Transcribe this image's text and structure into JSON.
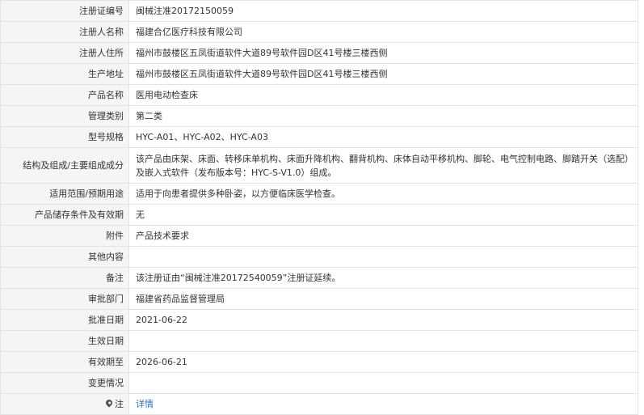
{
  "rows": [
    {
      "label": "注册证编号",
      "value": "闽械注准20172150059"
    },
    {
      "label": "注册人名称",
      "value": "福建合亿医疗科技有限公司"
    },
    {
      "label": "注册人住所",
      "value": "福州市鼓楼区五凤街道软件大道89号软件园D区41号楼三楼西侧"
    },
    {
      "label": "生产地址",
      "value": "福州市鼓楼区五凤街道软件大道89号软件园D区41号楼三楼西侧"
    },
    {
      "label": "产品名称",
      "value": "医用电动检查床"
    },
    {
      "label": "管理类别",
      "value": "第二类"
    },
    {
      "label": "型号规格",
      "value": "HYC-A01、HYC-A02、HYC-A03"
    },
    {
      "label": "结构及组成/主要组成成分",
      "value": "该产品由床架、床面、转移床单机构、床面升降机构、翻背机构、床体自动平移机构、脚轮、电气控制电路、脚踏开关（选配）及嵌入式软件（发布版本号：HYC-S-V1.0）组成。"
    },
    {
      "label": "适用范围/预期用途",
      "value": "适用于向患者提供多种卧姿，以方便临床医学检查。"
    },
    {
      "label": "产品储存条件及有效期",
      "value": "无"
    },
    {
      "label": "附件",
      "value": "产品技术要求"
    },
    {
      "label": "其他内容",
      "value": ""
    },
    {
      "label": "备注",
      "value": "该注册证由“闽械注准20172540059”注册证延续。"
    },
    {
      "label": "审批部门",
      "value": "福建省药品监督管理局"
    },
    {
      "label": "批准日期",
      "value": "2021-06-22"
    },
    {
      "label": "生效日期",
      "value": ""
    },
    {
      "label": "有效期至",
      "value": "2026-06-21"
    },
    {
      "label": "变更情况",
      "value": ""
    }
  ],
  "note_row": {
    "label": "注",
    "link_text": "详情",
    "icon": "pin-icon"
  },
  "colors": {
    "label_bg": "#f5f5f5",
    "border": "#e3e3e3",
    "link": "#2a6fc9",
    "text": "#333333"
  }
}
